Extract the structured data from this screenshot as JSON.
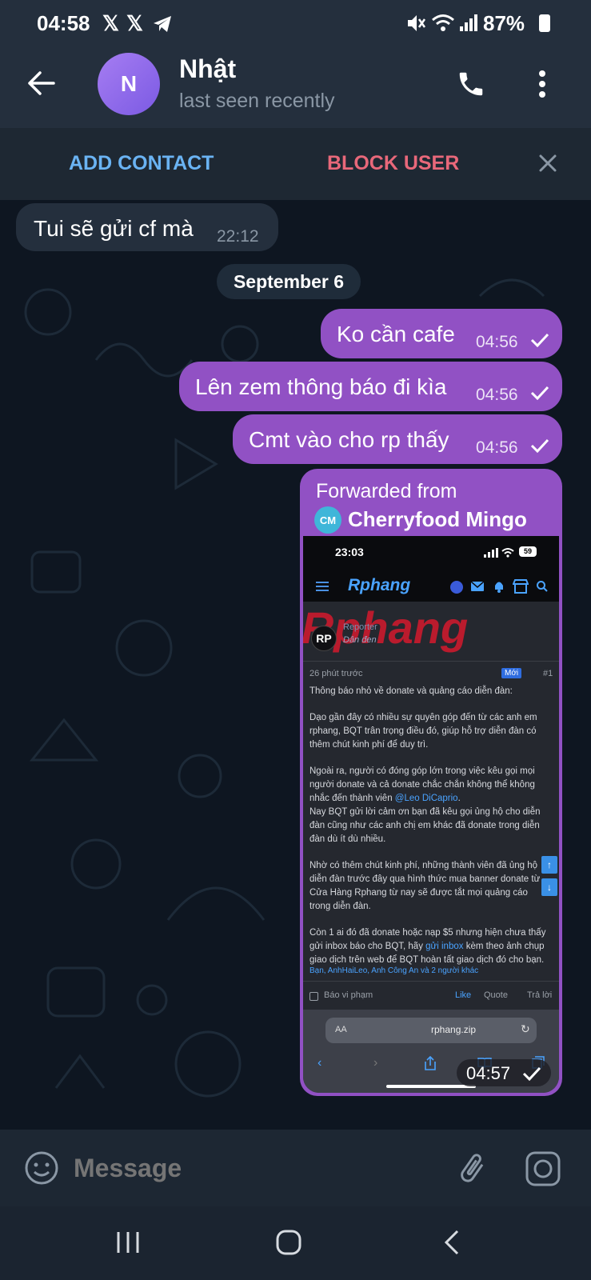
{
  "status_bar": {
    "time": "04:58",
    "notif_icons": [
      "x-icon",
      "x-icon",
      "telegram-icon"
    ],
    "battery": "87%"
  },
  "header": {
    "avatar_letter": "N",
    "name": "Nhật",
    "status": "last seen recently"
  },
  "action_bar": {
    "add_contact": "ADD CONTACT",
    "block_user": "BLOCK USER"
  },
  "messages": {
    "m1": {
      "text": "Tui sẽ gửi cf mà",
      "time": "22:12"
    },
    "date": "September 6",
    "m2": {
      "text": "Ko cần cafe",
      "time": "04:56"
    },
    "m3": {
      "text": "Lên zem thông báo đi kìa",
      "time": "04:56"
    },
    "m4": {
      "text": "Cmt vào cho rp thấy",
      "time": "04:56"
    },
    "forward": {
      "label": "Forwarded from",
      "source_initials": "CM",
      "source_name": "Cherryfood Mingo",
      "time": "04:57"
    }
  },
  "screenshot": {
    "time": "23:03",
    "battery": "59",
    "logo": "Rphang",
    "watermark": "Rphang",
    "avatar": "RP",
    "role": "Reporter",
    "rank": "Dân đen",
    "post_age": "26 phút trước",
    "new_badge": "Mới",
    "post_num": "#1",
    "title": "Thông báo nhỏ về donate và quảng cáo diễn đàn:",
    "p1": "Dạo gần đây có nhiều sự quyên góp đến từ các anh em rphang, BQT trân trọng điều đó, giúp hỗ trợ diễn đàn có thêm chút kinh phí để duy trì.",
    "p2a": "Ngoài ra, người có đóng góp lớn trong việc kêu gọi mọi người donate và cả donate chắc chắn không thể không nhắc đến thành viên ",
    "p2link": "@Leo DiCaprio",
    "p2b": ".",
    "p3": "Nay BQT gửi lời cảm ơn bạn đã kêu gọi ủng hộ cho diễn đàn cũng như các anh chị em khác đã donate trong diễn đàn dù ít dù nhiều.",
    "p4": "Nhờ có thêm chút kinh phí, những thành viên đã ủng hộ diễn đàn trước đây qua hình thức mua banner donate từ Cửa Hàng Rphang từ nay sẽ được tắt mọi quảng cáo trong diễn đàn.",
    "p5a": "Còn 1 ai đó đã donate hoặc nạp $5 nhưng hiện chưa thấy gửi inbox báo cho BQT, hãy ",
    "p5link": "gửi inbox",
    "p5b": " kèm theo ảnh chụp giao dịch trên web để BQT hoàn tất giao dịch đó cho bạn.",
    "reactions": "Bạn, AnhHaiLeo, Anh Công An và 2 người khác",
    "report": "Báo vi phạm",
    "like": "Like",
    "quote": "Quote",
    "reply": "Trả lời",
    "aa": "AA",
    "url": "rphang.zip"
  },
  "composer": {
    "placeholder": "Message"
  },
  "colors": {
    "accent_purple": "#9151c4",
    "link_blue": "#6ab3f3",
    "block_red": "#e8687a",
    "chat_bg": "#0e1621",
    "bar_bg": "#242f3d"
  }
}
